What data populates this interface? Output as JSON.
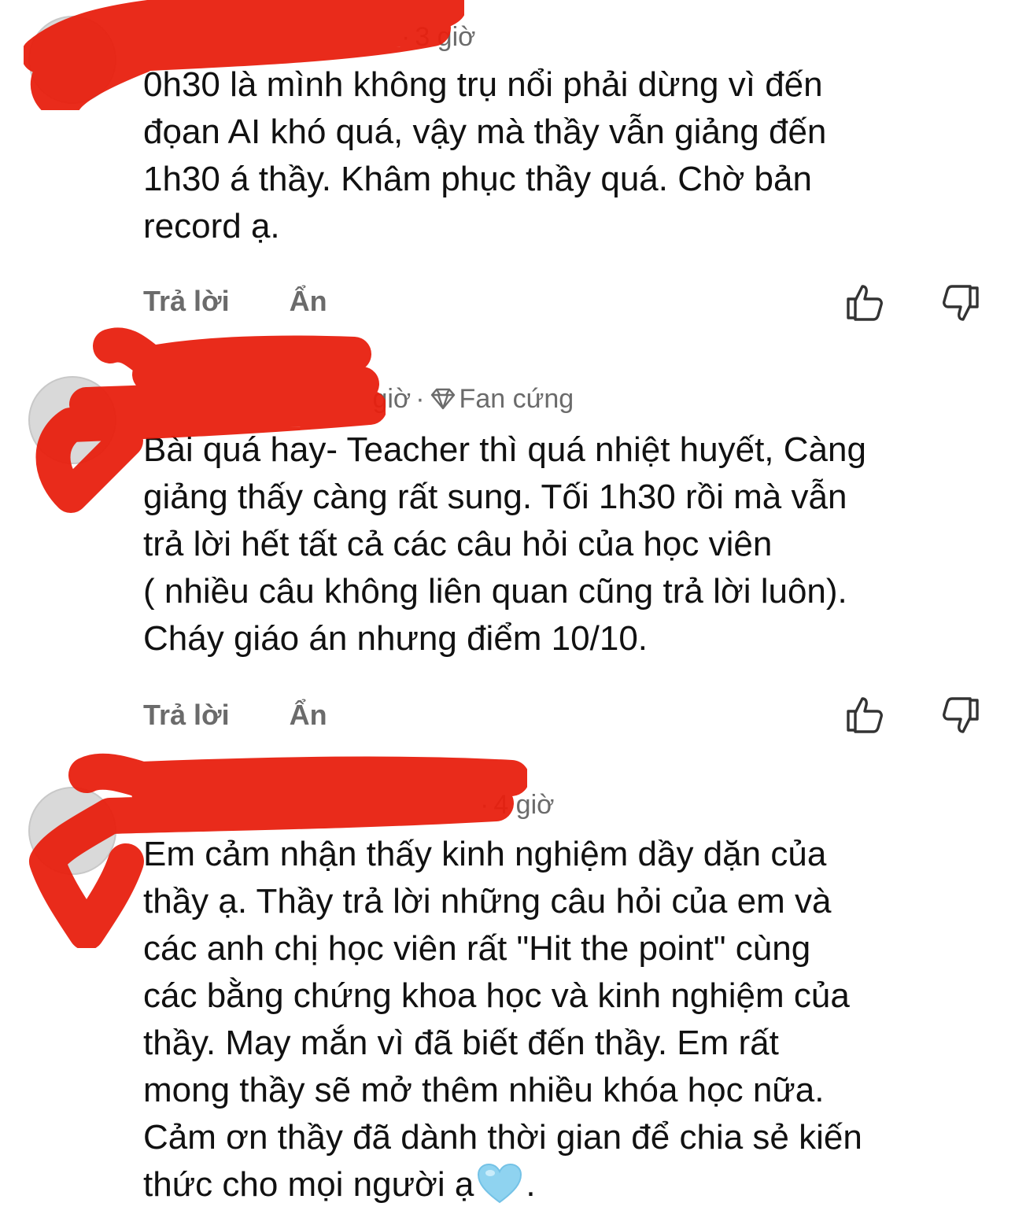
{
  "comments": [
    {
      "time": "3 giờ",
      "text": "0h30 là mình không trụ nổi phải dừng vì đến\nđọan AI khó quá, vậy mà thầy vẫn giảng đến\n1h30 á thầy. Khâm phục thầy quá. Chờ bản\nrecord ạ.",
      "reply_label": "Trả lời",
      "hide_label": "Ẩn"
    },
    {
      "time": "giờ",
      "badge": "Fan cứng",
      "text": "Bài quá hay- Teacher thì quá nhiệt huyết, Càng\ngiảng thấy càng rất sung. Tối 1h30 rồi mà vẫn\ntrả lời hết tất cả các câu hỏi của học viên\n( nhiều câu không liên quan cũng trả lời luôn).\nCháy giáo án nhưng điểm 10/10.",
      "reply_label": "Trả lời",
      "hide_label": "Ẩn"
    },
    {
      "time": "4 giờ",
      "text": "Em cảm nhận thấy kinh nghiệm dầy dặn của\nthầy ạ. Thầy trả lời những câu hỏi của em và\ncác anh chị học viên rất \"Hit the point\" cùng\ncác bằng chứng khoa học và kinh nghiệm của\nthầy. May mắn vì đã biết đến thầy. Em rất\nmong thầy sẽ mở thêm nhiều khóa học nữa.\nCảm ơn thầy đã dành thời gian để chia sẻ kiến\nthức cho mọi người ạ",
      "text_end": ".",
      "emoji": "light-blue-heart"
    }
  ],
  "icons": {
    "like": "thumbs-up-icon",
    "dislike": "thumbs-down-icon",
    "badge": "diamond-icon"
  },
  "colors": {
    "redaction": "#e8200f",
    "heart": "#8fd3f0",
    "meta_text": "#6b6b6b"
  }
}
